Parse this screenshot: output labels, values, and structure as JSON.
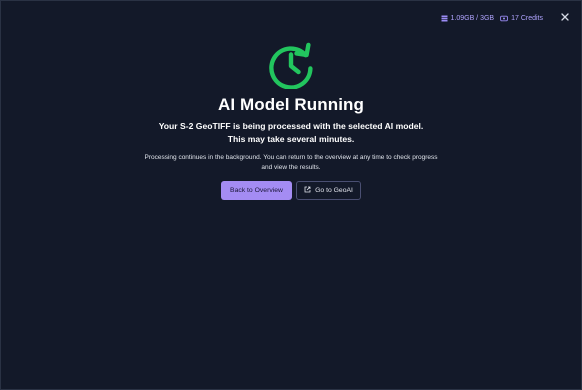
{
  "header": {
    "storage_label": "1.09GB / 3GB",
    "credits_label": "17 Credits",
    "storage_icon": "storage-icon",
    "credits_icon": "credits-icon",
    "close_icon": "close-icon"
  },
  "status": {
    "icon": "refresh-clock-icon",
    "title": "AI Model Running",
    "message": "Your S-2 GeoTIFF is being processed with the selected AI model. This may take several minutes.",
    "note": "Processing continues in the background. You can return to the overview at any time to check progress and view the results."
  },
  "actions": {
    "back_label": "Back to Overview",
    "geoai_label": "Go to GeoAI",
    "geoai_icon": "external-link-icon"
  },
  "colors": {
    "background": "#131929",
    "accent": "#a48cf3",
    "status_green": "#22c55e",
    "header_text": "#b0a4ff"
  }
}
